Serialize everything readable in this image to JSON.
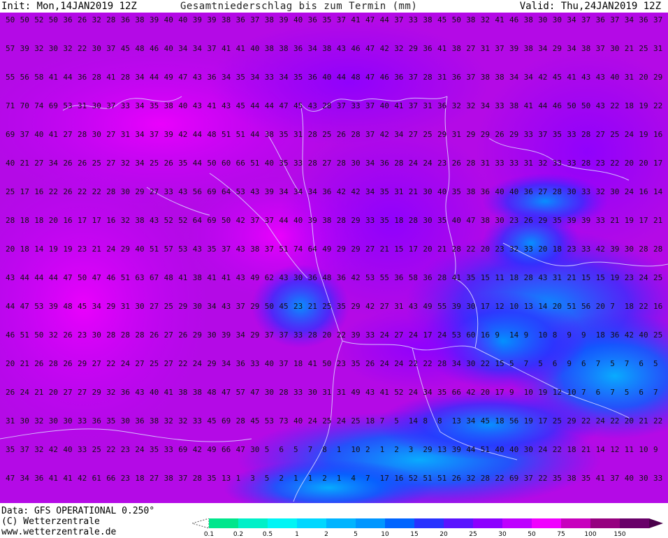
{
  "header": {
    "init": "Init: Mon,14JAN2019 12Z",
    "title": "Gesamtniederschlag bis zum Termin (mm)",
    "valid": "Valid: Thu,24JAN2019 12Z"
  },
  "footer": {
    "data_source": "Data: GFS OPERATIONAL 0.250°",
    "copyright": "(C) Wetterzentrale",
    "website": "www.wetterzentrale.de"
  },
  "legend": {
    "labels": [
      "0.1",
      "0.2",
      "0.5",
      "1",
      "2",
      "5",
      "10",
      "15",
      "20",
      "25",
      "30",
      "50",
      "75",
      "100",
      "150"
    ],
    "colors": [
      "#00e68c",
      "#00f0c8",
      "#00f5f5",
      "#00d7ff",
      "#00b4ff",
      "#0096ff",
      "#0064ff",
      "#2832ff",
      "#5a14ff",
      "#8c00ff",
      "#be00ff",
      "#f000ff",
      "#c800be",
      "#96007f",
      "#690069"
    ]
  },
  "map": {
    "grid_values": [
      [
        50,
        50,
        52,
        50,
        36,
        26,
        32,
        28,
        36,
        38,
        39,
        40,
        40,
        39,
        39,
        38,
        36,
        37,
        38,
        39,
        40,
        36,
        35,
        37,
        41,
        47,
        44,
        37,
        33,
        38,
        45,
        50,
        38,
        32,
        41,
        46,
        38,
        30,
        30,
        34,
        37,
        36,
        37,
        34,
        36,
        37
      ],
      [
        57,
        39,
        32,
        30,
        32,
        22,
        30,
        37,
        45,
        48,
        46,
        40,
        34,
        34,
        37,
        41,
        41,
        40,
        38,
        38,
        36,
        34,
        38,
        43,
        46,
        47,
        42,
        32,
        29,
        36,
        41,
        38,
        27,
        31,
        37,
        39,
        38,
        34,
        29,
        34,
        38,
        37,
        30,
        21,
        25,
        31
      ],
      [
        55,
        56,
        58,
        41,
        44,
        36,
        28,
        41,
        28,
        34,
        44,
        49,
        47,
        43,
        36,
        34,
        35,
        34,
        33,
        34,
        35,
        36,
        40,
        44,
        48,
        47,
        46,
        36,
        37,
        28,
        31,
        36,
        37,
        38,
        38,
        34,
        34,
        42,
        45,
        41,
        43,
        43,
        40,
        31,
        20,
        29
      ],
      [
        71,
        70,
        74,
        69,
        53,
        31,
        30,
        37,
        33,
        34,
        35,
        38,
        40,
        43,
        41,
        43,
        45,
        44,
        44,
        47,
        45,
        43,
        28,
        37,
        33,
        37,
        40,
        41,
        37,
        31,
        36,
        32,
        32,
        34,
        33,
        38,
        41,
        44,
        46,
        50,
        50,
        43,
        22,
        18,
        19,
        22
      ],
      [
        69,
        37,
        40,
        41,
        27,
        28,
        30,
        27,
        31,
        34,
        37,
        39,
        42,
        44,
        48,
        51,
        51,
        44,
        38,
        35,
        31,
        28,
        25,
        26,
        28,
        37,
        42,
        34,
        27,
        25,
        29,
        31,
        29,
        29,
        26,
        29,
        33,
        37,
        35,
        33,
        28,
        27,
        25,
        24,
        19,
        16
      ],
      [
        40,
        21,
        27,
        34,
        26,
        26,
        25,
        27,
        32,
        34,
        25,
        26,
        35,
        44,
        50,
        60,
        66,
        51,
        40,
        35,
        33,
        28,
        27,
        28,
        30,
        34,
        36,
        28,
        24,
        24,
        23,
        26,
        28,
        31,
        33,
        33,
        31,
        32,
        33,
        33,
        28,
        23,
        22,
        20,
        20,
        17
      ],
      [
        25,
        17,
        16,
        22,
        26,
        22,
        22,
        28,
        30,
        29,
        27,
        33,
        43,
        56,
        69,
        64,
        53,
        43,
        39,
        34,
        34,
        34,
        36,
        42,
        42,
        34,
        35,
        31,
        21,
        30,
        40,
        35,
        38,
        36,
        40,
        40,
        36,
        27,
        28,
        30,
        33,
        32,
        30,
        24,
        16,
        14
      ],
      [
        28,
        18,
        18,
        20,
        16,
        17,
        17,
        16,
        32,
        38,
        43,
        52,
        52,
        64,
        69,
        50,
        42,
        37,
        37,
        44,
        40,
        39,
        38,
        28,
        29,
        33,
        35,
        18,
        28,
        30,
        35,
        40,
        47,
        38,
        30,
        23,
        26,
        29,
        35,
        39,
        39,
        33,
        21,
        19,
        17,
        21
      ],
      [
        20,
        18,
        14,
        19,
        19,
        23,
        21,
        24,
        29,
        40,
        51,
        57,
        53,
        43,
        35,
        37,
        43,
        38,
        37,
        51,
        74,
        64,
        49,
        29,
        29,
        27,
        21,
        15,
        17,
        20,
        21,
        28,
        22,
        20,
        23,
        32,
        33,
        20,
        18,
        23,
        33,
        42,
        39,
        30,
        28,
        28
      ],
      [
        43,
        44,
        44,
        44,
        47,
        50,
        47,
        46,
        51,
        63,
        67,
        48,
        41,
        38,
        41,
        41,
        43,
        49,
        62,
        43,
        30,
        36,
        48,
        36,
        42,
        53,
        55,
        36,
        58,
        36,
        28,
        41,
        35,
        15,
        11,
        18,
        28,
        43,
        31,
        21,
        15,
        15,
        19,
        23,
        24,
        25
      ],
      [
        44,
        47,
        53,
        39,
        48,
        45,
        34,
        29,
        31,
        30,
        27,
        25,
        29,
        30,
        34,
        43,
        37,
        29,
        50,
        45,
        23,
        21,
        25,
        35,
        29,
        42,
        27,
        31,
        43,
        49,
        55,
        39,
        30,
        17,
        12,
        10,
        13,
        14,
        20,
        51,
        56,
        20,
        7,
        18,
        22,
        16
      ],
      [
        46,
        51,
        50,
        32,
        26,
        23,
        30,
        28,
        28,
        28,
        26,
        27,
        26,
        29,
        30,
        39,
        34,
        29,
        37,
        37,
        33,
        28,
        20,
        22,
        39,
        33,
        24,
        27,
        24,
        17,
        24,
        53,
        60,
        16,
        9,
        14,
        9,
        10,
        8,
        9,
        9,
        18,
        36,
        42,
        40,
        25
      ],
      [
        20,
        21,
        26,
        28,
        26,
        29,
        27,
        22,
        24,
        27,
        25,
        27,
        22,
        24,
        29,
        34,
        36,
        33,
        40,
        37,
        18,
        41,
        50,
        23,
        35,
        26,
        24,
        24,
        22,
        22,
        28,
        34,
        30,
        22,
        15,
        5,
        7,
        5,
        6,
        9,
        6,
        7,
        5,
        7,
        6,
        5
      ],
      [
        26,
        24,
        21,
        20,
        27,
        27,
        29,
        32,
        36,
        43,
        40,
        41,
        38,
        38,
        48,
        47,
        57,
        47,
        30,
        28,
        33,
        30,
        31,
        31,
        49,
        43,
        41,
        52,
        24,
        34,
        35,
        66,
        42,
        20,
        17,
        9,
        10,
        19,
        12,
        10,
        7,
        6,
        7,
        5,
        6,
        7
      ],
      [
        31,
        30,
        32,
        30,
        30,
        33,
        36,
        35,
        30,
        36,
        38,
        32,
        32,
        33,
        45,
        69,
        28,
        45,
        53,
        73,
        40,
        24,
        25,
        24,
        25,
        18,
        7,
        5,
        14,
        8,
        8,
        13,
        34,
        45,
        18,
        56,
        19,
        17,
        25,
        29,
        22,
        24,
        22,
        20,
        21,
        22
      ],
      [
        35,
        37,
        32,
        42,
        40,
        33,
        25,
        22,
        23,
        24,
        35,
        33,
        69,
        42,
        49,
        66,
        47,
        30,
        5,
        6,
        5,
        7,
        8,
        1,
        10,
        2,
        1,
        2,
        3,
        29,
        13,
        39,
        44,
        51,
        40,
        40,
        30,
        24,
        22,
        18,
        21,
        14,
        12,
        11,
        10,
        9
      ],
      [
        47,
        34,
        36,
        41,
        41,
        42,
        61,
        66,
        23,
        18,
        27,
        38,
        37,
        28,
        35,
        13,
        1,
        3,
        5,
        2,
        1,
        1,
        2,
        1,
        4,
        7,
        17,
        16,
        52,
        51,
        51,
        26,
        32,
        28,
        22,
        69,
        37,
        22,
        35,
        38,
        35,
        41,
        37,
        40,
        30,
        33
      ]
    ]
  }
}
